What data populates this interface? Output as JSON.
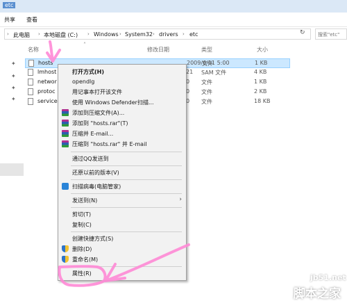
{
  "window": {
    "title": "etc"
  },
  "ribbon": {
    "tabs": [
      "共享",
      "查看"
    ]
  },
  "address": {
    "crumbs": [
      "此电脑",
      "本地磁盘 (C:)",
      "Windows",
      "System32",
      "drivers",
      "etc"
    ],
    "search_placeholder": "搜索\"etc\""
  },
  "columns": {
    "name": "名称",
    "date": "修改日期",
    "type": "类型",
    "size": "大小"
  },
  "files": [
    {
      "name": "hosts",
      "date": "2009/6/11 5:00",
      "type": "文件",
      "size": "1 KB",
      "selected": true
    },
    {
      "name": "lmhost",
      "date": "21",
      "type": "SAM 文件",
      "size": "4 KB"
    },
    {
      "name": "networ",
      "date": "0",
      "type": "文件",
      "size": "1 KB"
    },
    {
      "name": "protoc",
      "date": "0",
      "type": "文件",
      "size": "2 KB"
    },
    {
      "name": "service",
      "date": "0",
      "type": "文件",
      "size": "18 KB"
    }
  ],
  "context_menu": {
    "open_with": "打开方式(H)",
    "opendlg": "opendlg",
    "notepad": "用记事本打开该文件",
    "defender": "使用 Windows Defender扫描...",
    "add_archive": "添加到压缩文件(A)...",
    "add_hosts_rar": "添加到 \"hosts.rar\"(T)",
    "compress_email": "压缩并 E-mail...",
    "compress_rar_email": "压缩到 \"hosts.rar\" 并 E-mail",
    "qq_send": "通过QQ发送到",
    "restore": "还原以前的版本(V)",
    "virus_scan": "扫描病毒(电脑管家)",
    "send_to": "发送到(N)",
    "cut": "剪切(T)",
    "copy": "复制(C)",
    "shortcut": "创建快捷方式(S)",
    "delete": "删除(D)",
    "rename": "重命名(M)",
    "properties": "属性(R)"
  },
  "watermark": {
    "site": "jb51.net",
    "brand": "脚本之家"
  },
  "colors": {
    "selection": "#cce8ff",
    "annotation": "#ff7fd0"
  },
  "icons": [
    "file-icon",
    "pin-icon",
    "refresh-icon",
    "winrar-icon",
    "shield-icon",
    "qq-icon"
  ]
}
